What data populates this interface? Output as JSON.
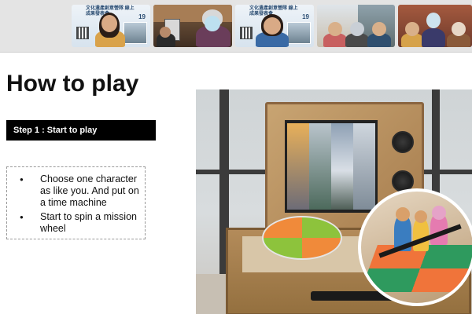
{
  "participants": [
    {
      "id": "tile-1",
      "banner": "文化遺產創意營隊 線上成果發表會",
      "number": "19"
    },
    {
      "id": "tile-2"
    },
    {
      "id": "tile-3",
      "banner": "文化遺產創意營隊 線上成果發表會",
      "number": "19"
    },
    {
      "id": "tile-4"
    },
    {
      "id": "tile-5"
    }
  ],
  "slide": {
    "title": "How to play",
    "step_label": "Step 1 : Start to play",
    "bullets": [
      "Choose one character as like you. And put on a time machine",
      "Start to spin a mission wheel"
    ]
  },
  "colors": {
    "step_bg": "#000000",
    "wheel_green": "#8dc33c",
    "wheel_orange": "#f08a3a"
  }
}
